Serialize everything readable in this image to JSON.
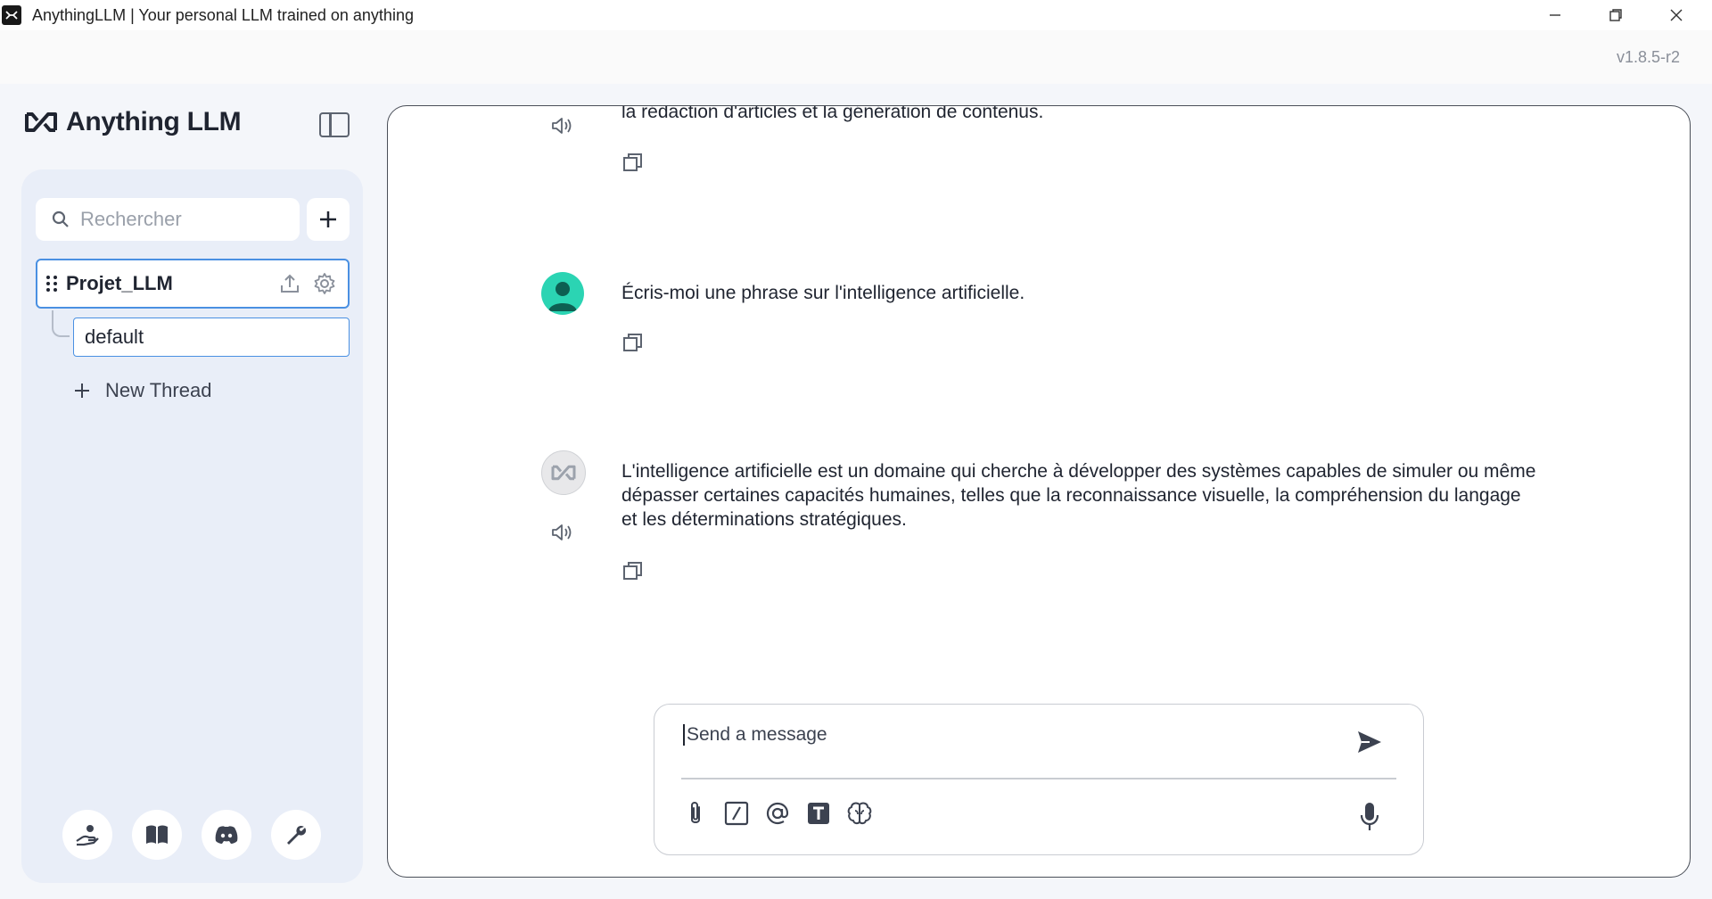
{
  "window": {
    "title": "AnythingLLM | Your personal LLM trained on anything",
    "version": "v1.8.5-r2"
  },
  "brand": {
    "name": "Anything LLM"
  },
  "sidebar": {
    "search_placeholder": "Rechercher",
    "workspace": {
      "name": "Projet_LLM"
    },
    "thread": {
      "name": "default"
    },
    "new_thread_label": "New Thread",
    "footer_icons": [
      "community-hub-icon",
      "docs-icon",
      "discord-icon",
      "settings-wrench-icon"
    ]
  },
  "chat": {
    "messages": [
      {
        "role": "assistant",
        "text": "la rédaction d'articles et la génération de contenus."
      },
      {
        "role": "user",
        "text": "Écris-moi une phrase sur l'intelligence artificielle."
      },
      {
        "role": "assistant",
        "text": "L'intelligence artificielle est un domaine qui cherche à développer des systèmes capables de simuler ou même dépasser certaines capacités humaines, telles que la reconnaissance visuelle, la compréhension du langage et les déterminations stratégiques."
      }
    ],
    "composer": {
      "placeholder": "Send a message",
      "tool_icons": [
        "attachment-icon",
        "slash-command-icon",
        "at-mention-icon",
        "text-size-icon",
        "agent-brain-icon"
      ]
    }
  },
  "colors": {
    "accent": "#4a90e2",
    "user_avatar": "#2bd4b3",
    "sidebar_bg": "#e9eef8"
  }
}
